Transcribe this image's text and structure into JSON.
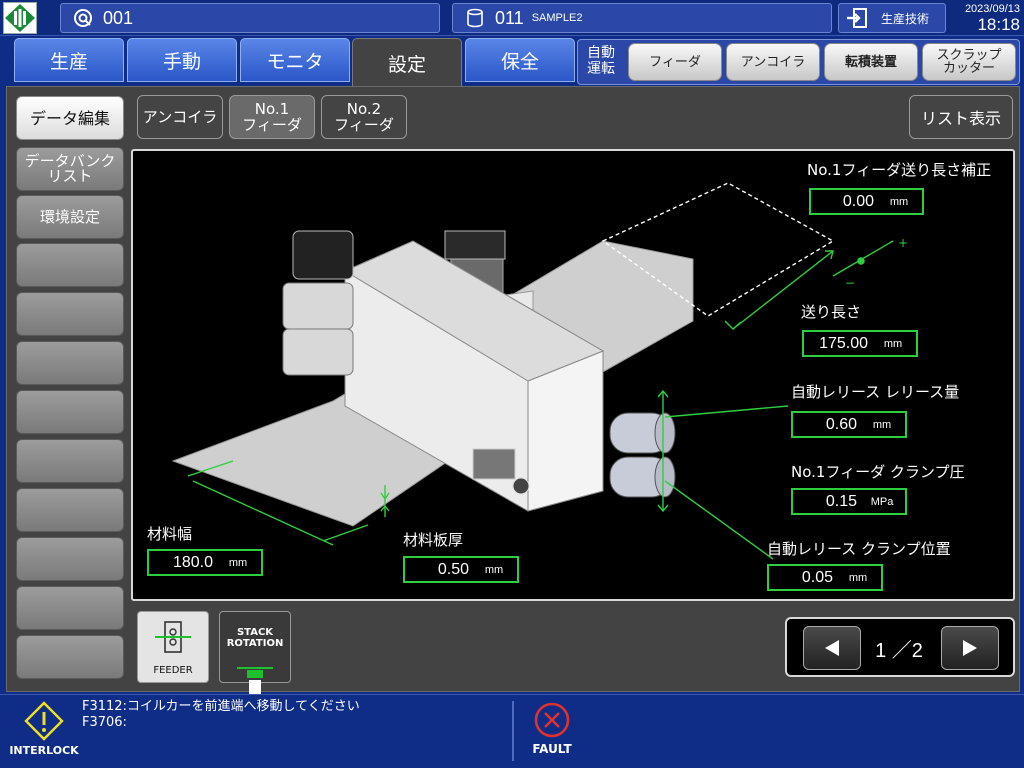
{
  "header": {
    "program_number": "001",
    "data_number": "011",
    "data_name": "SAMPLE2",
    "user_name": "生産技術",
    "date": "2023/09/13",
    "time": "18:18"
  },
  "main_tabs": [
    {
      "label": "生産",
      "active": false
    },
    {
      "label": "手動",
      "active": false
    },
    {
      "label": "モニタ",
      "active": false
    },
    {
      "label": "設定",
      "active": true
    },
    {
      "label": "保全",
      "active": false
    }
  ],
  "auto_run": {
    "label": "自動\n運転",
    "buttons": [
      "フィーダ",
      "アンコイラ",
      "転積装置",
      "スクラップ\nカッター"
    ]
  },
  "sidebar": {
    "items": [
      "データ編集",
      "データバンク\nリスト",
      "環境設定",
      "",
      "",
      "",
      "",
      "",
      "",
      "",
      "",
      ""
    ]
  },
  "sub_tabs": [
    {
      "label": "アンコイラ",
      "active": false
    },
    {
      "label": "No.1\nフィーダ",
      "active": true
    },
    {
      "label": "No.2\nフィーダ",
      "active": false
    }
  ],
  "list_button": "リスト表示",
  "params": {
    "feed_length_correction": {
      "label": "No.1フィーダ送り長さ補正",
      "value": "0.00",
      "unit": "mm"
    },
    "feed_length": {
      "label": "送り長さ",
      "value": "175.00",
      "unit": "mm"
    },
    "release_amount": {
      "label": "自動レリース レリース量",
      "value": "0.60",
      "unit": "mm"
    },
    "clamp_pressure": {
      "label": "No.1フィーダ クランプ圧",
      "value": "0.15",
      "unit": "MPa"
    },
    "clamp_position": {
      "label": "自動レリース クランプ位置",
      "value": "0.05",
      "unit": "mm"
    },
    "material_width": {
      "label": "材料幅",
      "value": "180.0",
      "unit": "mm"
    },
    "material_thickness": {
      "label": "材料板厚",
      "value": "0.50",
      "unit": "mm"
    }
  },
  "plus_sign": "+",
  "minus_sign": "−",
  "modes": [
    {
      "label": "FEEDER",
      "active": true
    },
    {
      "label": "STACK\nROTATION",
      "active": false
    }
  ],
  "pager": {
    "text": "1 ／2"
  },
  "alarms": {
    "interlock_label": "INTERLOCK",
    "messages": [
      "F3112:コイルカーを前進端へ移動してください",
      "F3706:"
    ],
    "fault_label": "FAULT"
  },
  "colors": {
    "accent_green": "#2ecf3e",
    "bar_blue": "#0f2d86",
    "tab_blue": "#3a66d8",
    "panel_gray": "#434343",
    "warning_yellow": "#f0e020",
    "fault_red": "#e03030"
  }
}
